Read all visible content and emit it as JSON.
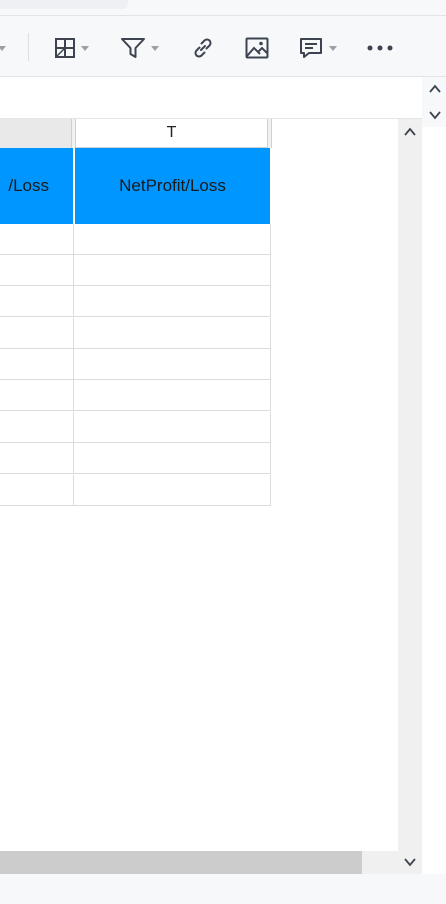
{
  "sheet": {
    "column_header_partial": "",
    "column_header_t": "T",
    "header_partial_text": "/Loss",
    "header_t_text": "NetProfit/Loss",
    "empty_rows": 9,
    "header_bg_color": "#0096ff"
  },
  "toolbar": {
    "icons": [
      "table-border-icon",
      "filter-icon",
      "link-icon",
      "image-icon",
      "comment-icon",
      "more-icon"
    ]
  }
}
